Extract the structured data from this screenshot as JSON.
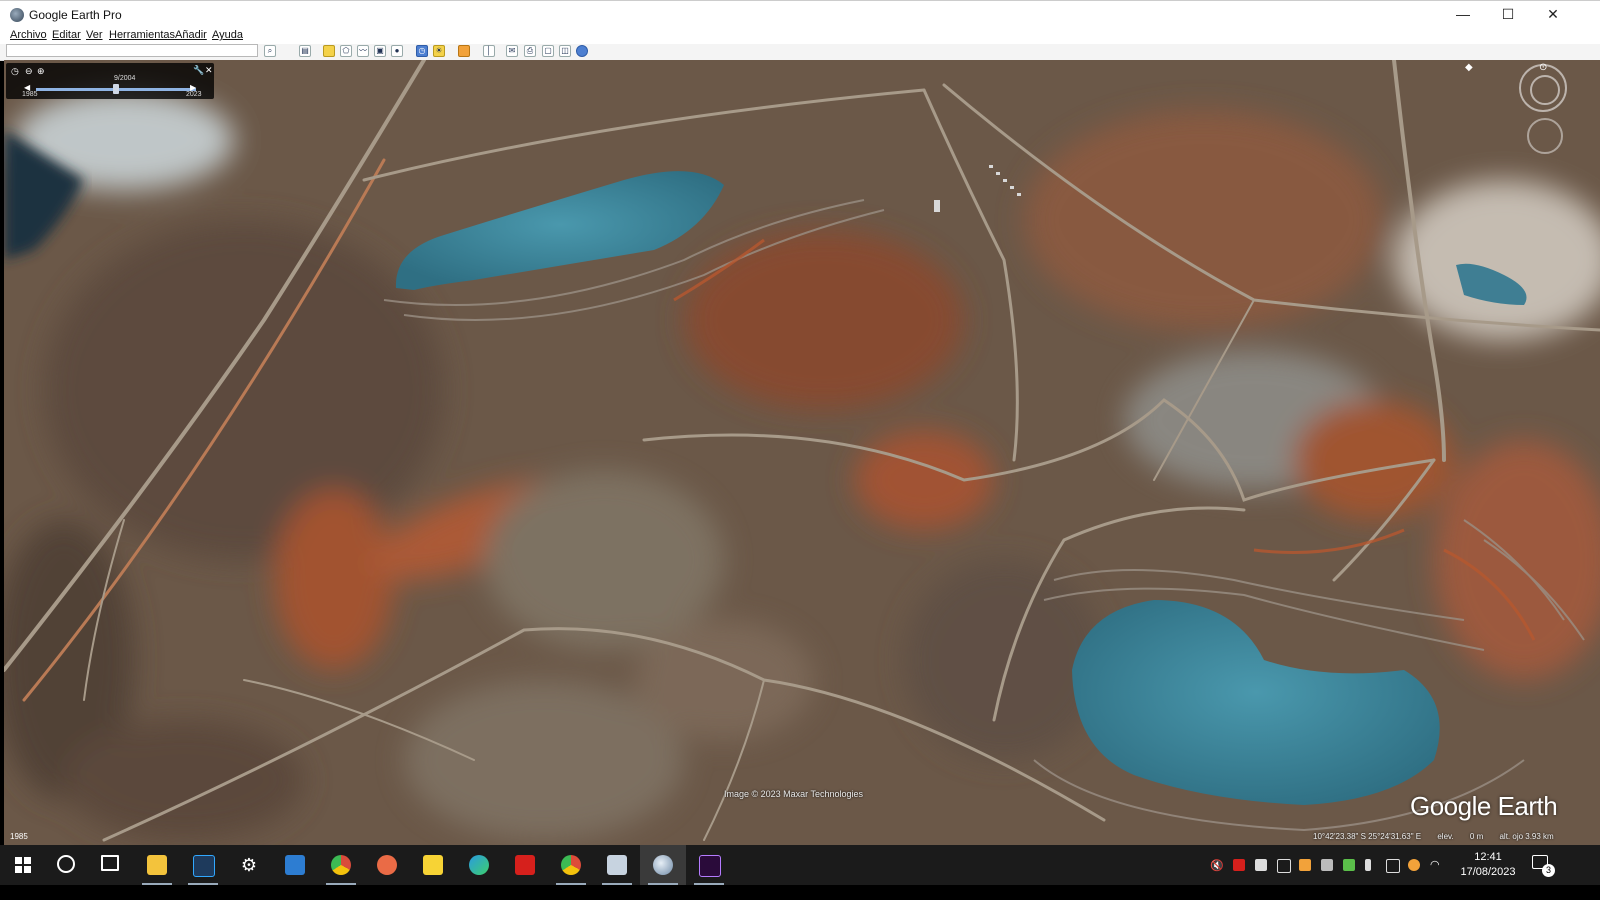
{
  "window": {
    "title": "Google Earth Pro",
    "minimize_glyph": "—",
    "maximize_glyph": "☐",
    "close_glyph": "✕"
  },
  "menu": [
    "Archivo",
    "Editar",
    "Ver",
    "Herramientas",
    "Añadir",
    "Ayuda"
  ],
  "search": {
    "value": "",
    "placeholder": ""
  },
  "toolbar_icons": [
    "search-icon",
    "sidebar-toggle-icon",
    "placemark-icon",
    "polygon-icon",
    "path-icon",
    "image-overlay-icon",
    "record-tour-icon",
    "historical-imagery-icon",
    "sun-icon",
    "planets-icon",
    "ruler-icon",
    "email-icon",
    "print-icon",
    "save-image-icon",
    "view-in-maps-icon",
    "globe-icon"
  ],
  "time_slider": {
    "current_date": "9/2004",
    "start_year": "1985",
    "end_year": "2023",
    "position_fraction": 0.5
  },
  "map": {
    "attribution": "Image © 2023 Maxar Technologies",
    "watermark": "Google Earth",
    "status": {
      "coords": "10°42'23.38\" S  25°24'31.63\" E",
      "elev_label": "elev.",
      "elev_value": "0 m",
      "eye_alt": "alt. ojo  3.93 km"
    },
    "year_label": "1985"
  },
  "taskbar": {
    "apps": [
      {
        "name": "start",
        "color": "#ffffff"
      },
      {
        "name": "search",
        "color": "#ffffff"
      },
      {
        "name": "task-view",
        "color": "#ffffff"
      },
      {
        "name": "file-explorer",
        "color": "#f3c33c"
      },
      {
        "name": "photoshop",
        "color": "#1e3a5c"
      },
      {
        "name": "settings",
        "color": "#ffffff"
      },
      {
        "name": "mail",
        "color": "#2d7dd2"
      },
      {
        "name": "chrome-profile",
        "color": "#d94b3b"
      },
      {
        "name": "paint",
        "color": "#ea6b46"
      },
      {
        "name": "sticky-notes",
        "color": "#f7d335"
      },
      {
        "name": "edge",
        "color": "#2a9be0"
      },
      {
        "name": "acrobat",
        "color": "#d6201c"
      },
      {
        "name": "chrome",
        "color": "#dd4b39"
      },
      {
        "name": "explorer-window",
        "color": "#c7d3e0"
      },
      {
        "name": "google-earth",
        "color": "#9ab0c8"
      },
      {
        "name": "premiere",
        "color": "#2a0b3a"
      }
    ],
    "clock_time": "12:41",
    "clock_date": "17/08/2023",
    "notification_count": "3"
  },
  "colors": {
    "map_base": "#6f5a47",
    "lake": "#3f8aa0",
    "taskbar": "#1b1b1b",
    "rust": "#a8532f"
  }
}
